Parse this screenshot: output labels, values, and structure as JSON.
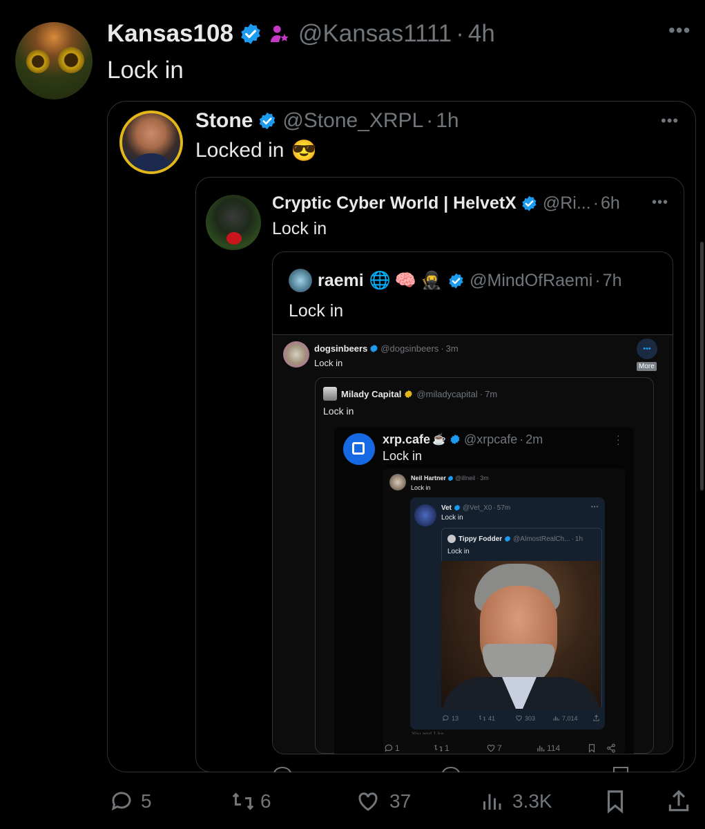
{
  "main": {
    "name": "Kansas108",
    "handle": "@Kansas1111",
    "sep": "·",
    "time": "4h",
    "text": "Lock in",
    "actions": {
      "replies": "5",
      "reposts": "6",
      "likes": "37",
      "views": "3.3K"
    }
  },
  "q1": {
    "name": "Stone",
    "handle": "@Stone_XRPL",
    "sep": "·",
    "time": "1h",
    "text": "Locked in",
    "emoji": "😎"
  },
  "q2": {
    "name": "Cryptic Cyber World | HelvetX",
    "handle": "@Ri...",
    "sep": "·",
    "time": "6h",
    "text": "Lock in"
  },
  "q3": {
    "name": "raemi",
    "handle": "@MindOfRaemi",
    "sep": "·",
    "time": "7h",
    "text": "Lock in"
  },
  "q4": {
    "name": "dogsinbeers",
    "handle": "@dogsinbeers",
    "sep": "·",
    "time": "3m",
    "text": "Lock in",
    "more_label": "More"
  },
  "q5": {
    "name": "Milady Capital",
    "handle": "@miladycapital",
    "sep": "·",
    "time": "7m",
    "text": "Lock in"
  },
  "q6": {
    "name": "xrp.cafe",
    "emoji": "☕",
    "handle": "@xrpcafe",
    "sep": "·",
    "time": "2m",
    "text": "Lock in"
  },
  "q7": {
    "name": "Neil Hartner",
    "handle": "@illneil",
    "sep": "·",
    "time": "3m",
    "text": "Lock in"
  },
  "q8": {
    "name": "Vet",
    "handle": "@Vet_X0",
    "sep": "·",
    "time": "57m",
    "text": "Lock in",
    "actions": {
      "replies": "13",
      "reposts": "41",
      "likes": "303",
      "views": "7,014"
    }
  },
  "q9": {
    "name": "Tippy Fodder",
    "handle": "@AlmostRealCh...",
    "sep": "·",
    "time": "1h",
    "text": "Lock in"
  },
  "inner_actions": {
    "replies": "1",
    "reposts": "1",
    "likes": "7",
    "views": "114"
  },
  "inner_caption": "You and 1 ka",
  "colors": {
    "verified": "#1d9bf0",
    "gold": "#e2b719",
    "accent_pink": "#c43ac4"
  }
}
